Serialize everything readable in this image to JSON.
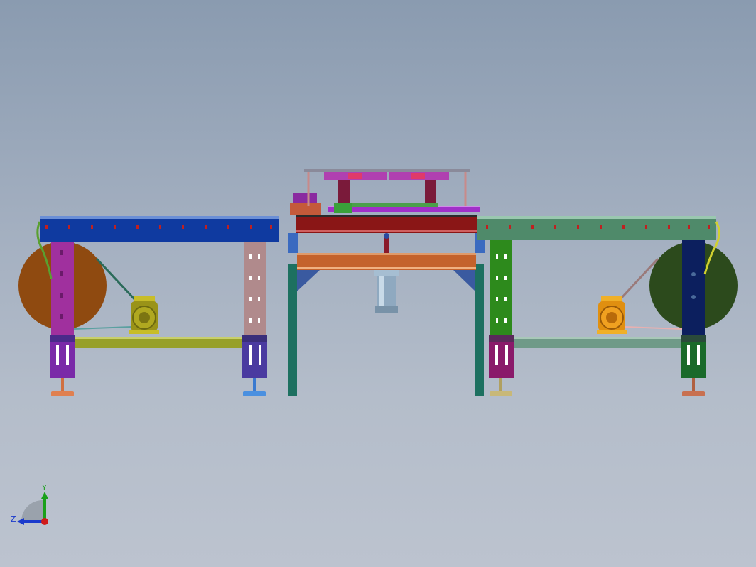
{
  "viewport": {
    "background_top": "#8a9bb0",
    "background_bottom": "#bcc3cf"
  },
  "colors": {
    "left_conveyor_beam": "#0f3aa0",
    "left_spool": "#8f4a10",
    "left_leg_front": "#a0309e",
    "left_leg_rear": "#b08a8c",
    "left_crossbar": "#97a02a",
    "left_motor": "#9a9318",
    "right_conveyor_beam": "#4f8a6a",
    "right_spool": "#2c4a1c",
    "right_leg_front": "#2d8a1c",
    "right_leg_rear": "#0c1f5e",
    "right_crossbar": "#6f9a88",
    "right_motor": "#e08f10",
    "center_top_beam": "#8a1616",
    "center_lower_beam": "#c4622c",
    "center_frame": "#1d7060",
    "cylinder": "#8fa9c0",
    "axis_y": "#1aa01a",
    "axis_z": "#1a3acc",
    "axis_x": "#d01a1a"
  },
  "triad": {
    "y_label": "Y",
    "z_label": "Z",
    "y_icon": "y-axis-arrow",
    "z_icon": "z-axis-arrow",
    "origin_icon": "x-axis-origin-dot"
  }
}
